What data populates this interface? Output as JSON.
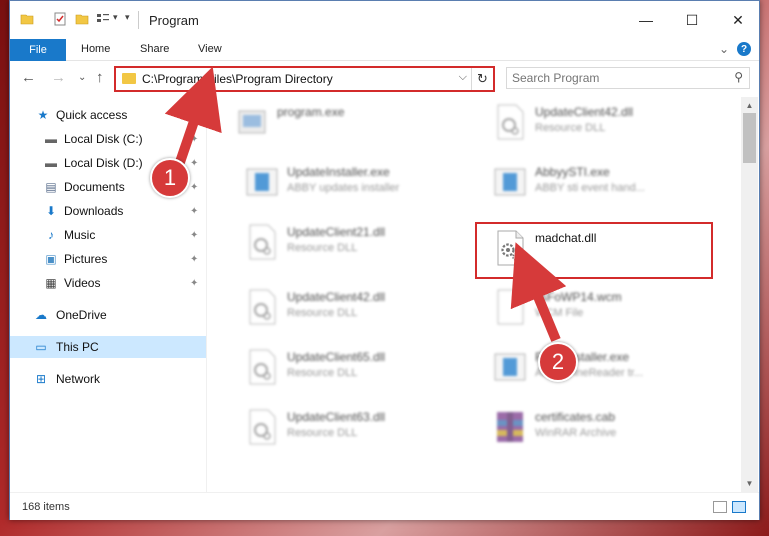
{
  "window": {
    "title": "Program",
    "controls": {
      "minimize": "—",
      "maximize": "☐",
      "close": "✕"
    }
  },
  "ribbon": {
    "file_tab": "File",
    "tabs": [
      "Home",
      "Share",
      "View"
    ],
    "expand_chevron": "⌄",
    "help": "?"
  },
  "nav": {
    "back": "←",
    "forward": "→",
    "recent": "⌄",
    "up": "↑",
    "address": "C:\\Program Files\\Program Directory",
    "address_dropdown": "⌵",
    "refresh": "↻",
    "search_placeholder": "Search Program",
    "search_icon": "⚲"
  },
  "sidebar": {
    "items": [
      {
        "label": "Quick access",
        "icon": "star-icon",
        "glyph": "★",
        "color": "#1979ca",
        "pinned": false
      },
      {
        "label": "Local Disk (C:)",
        "icon": "drive-icon",
        "glyph": "▬",
        "color": "#666666",
        "pinned": true
      },
      {
        "label": "Local Disk (D:)",
        "icon": "drive-icon",
        "glyph": "▬",
        "color": "#666666",
        "pinned": true
      },
      {
        "label": "Documents",
        "icon": "documents-icon",
        "glyph": "▤",
        "color": "#5a6e8c",
        "pinned": true
      },
      {
        "label": "Downloads",
        "icon": "download-icon",
        "glyph": "⬇",
        "color": "#1979ca",
        "pinned": true
      },
      {
        "label": "Music",
        "icon": "music-icon",
        "glyph": "♪",
        "color": "#1979ca",
        "pinned": true
      },
      {
        "label": "Pictures",
        "icon": "pictures-icon",
        "glyph": "▣",
        "color": "#4a90c8",
        "pinned": true
      },
      {
        "label": "Videos",
        "icon": "videos-icon",
        "glyph": "▦",
        "color": "#444444",
        "pinned": true
      },
      {
        "label": "OneDrive",
        "icon": "cloud-icon",
        "glyph": "☁",
        "color": "#1979ca",
        "pinned": false
      },
      {
        "label": "This PC",
        "icon": "computer-icon",
        "glyph": "▭",
        "color": "#1979ca",
        "pinned": false
      },
      {
        "label": "Network",
        "icon": "network-icon",
        "glyph": "⊞",
        "color": "#1979ca",
        "pinned": false
      }
    ],
    "pin_glyph": "📌"
  },
  "files": [
    {
      "name": "program.exe",
      "type": "",
      "icon": "exe-icon",
      "highlighted": false
    },
    {
      "name": "UpdateClient42.dll",
      "type": "Resource DLL",
      "icon": "dll-icon",
      "highlighted": false
    },
    {
      "name": "UpdateInstaller.exe",
      "type": "ABBY updates installer",
      "icon": "installer-icon",
      "highlighted": false
    },
    {
      "name": "AbbyySTI.exe",
      "type": "ABBY sti event hand...",
      "icon": "installer-icon",
      "highlighted": false
    },
    {
      "name": "UpdateClient21.dll",
      "type": "Resource DLL",
      "icon": "dll-icon",
      "highlighted": false
    },
    {
      "name": "madchat.dll",
      "type": "",
      "icon": "dll-icon",
      "highlighted": true
    },
    {
      "name": "UpdateClient42.dll",
      "type": "Resource DLL",
      "icon": "dll-icon",
      "highlighted": false
    },
    {
      "name": "TsFoWP14.wcm",
      "type": "WCM File",
      "icon": "blank-file-icon",
      "highlighted": false
    },
    {
      "name": "UpdateClient65.dll",
      "type": "Resource DLL",
      "icon": "dll-icon",
      "highlighted": false
    },
    {
      "name": "FontsInstaller.exe",
      "type": "ABBY FineReader tr...",
      "icon": "installer-icon",
      "highlighted": false
    },
    {
      "name": "UpdateClient63.dll",
      "type": "Resource DLL",
      "icon": "dll-icon",
      "highlighted": false
    },
    {
      "name": "certificates.cab",
      "type": "WinRAR Archive",
      "icon": "archive-icon",
      "highlighted": false
    }
  ],
  "status": {
    "item_count": "168 items"
  },
  "annotations": {
    "step1": "1",
    "step2": "2",
    "color": "#d32b2b"
  },
  "scrollbar": {
    "up": "▲",
    "down": "▼"
  }
}
